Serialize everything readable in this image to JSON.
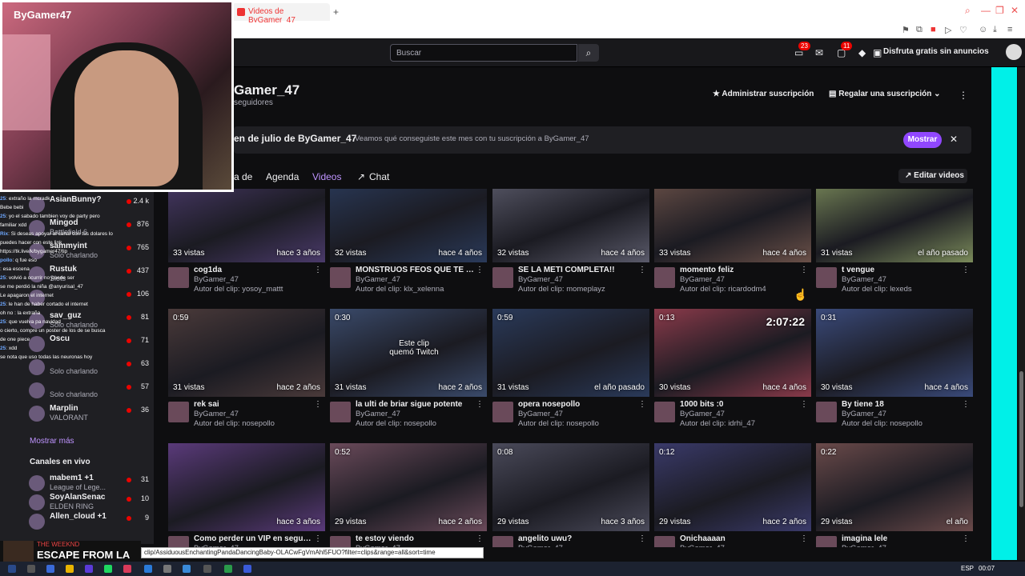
{
  "browser": {
    "tab_title": "Videos de ByGamer_47",
    "new_tab": "+",
    "win_controls": [
      "⌕",
      "—",
      "❐",
      "✕"
    ]
  },
  "topnav": {
    "search_placeholder": "Buscar",
    "notif_badge_1": "23",
    "notif_badge_2": "11",
    "adfree_label": "Disfruta gratis sin anuncios"
  },
  "webcam": {
    "logo_text": "ByGamer47"
  },
  "channel": {
    "name": "Gamer_47",
    "followers": "seguidores",
    "manage_sub": "Administrar suscripción",
    "gift_sub": "Regalar una suscripción"
  },
  "banner": {
    "title": "en de julio de ByGamer_47",
    "desc": "Veamos qué conseguiste este mes con tu suscripción a ByGamer_47",
    "show_btn": "Mostrar"
  },
  "tabs": {
    "t0": "a de",
    "t1": "Agenda",
    "t2": "Videos",
    "t3": "Chat",
    "edit": "Editar videos"
  },
  "sidebar": {
    "followed": [
      {
        "name": "AsianBunny?",
        "game": "",
        "viewers": "2.4 k"
      },
      {
        "name": "Mingod",
        "game": "Battlefield 6",
        "viewers": "876"
      },
      {
        "name": "sammyint",
        "game": "Solo charlando",
        "viewers": "765"
      },
      {
        "name": "Rustuk",
        "game": "Slots",
        "viewers": "437"
      },
      {
        "name": "",
        "game": "",
        "viewers": "106"
      },
      {
        "name": "sav_guz",
        "game": "Solo charlando",
        "viewers": "81"
      },
      {
        "name": "Oscu",
        "game": "",
        "viewers": "71"
      },
      {
        "name": "",
        "game": "Solo charlando",
        "viewers": "63"
      },
      {
        "name": "",
        "game": "Solo charlando",
        "viewers": "57"
      },
      {
        "name": "Marplin",
        "game": "VALORANT",
        "viewers": "36"
      }
    ],
    "show_more": "Mostrar más",
    "live_header": "Canales en vivo",
    "live": [
      {
        "name": "mabem1 +1",
        "game": "League of Lege...",
        "viewers": "31"
      },
      {
        "name": "SoyAlanSenac",
        "game": "ELDEN RING",
        "viewers": "10"
      },
      {
        "name": "Allen_cloud +1",
        "game": "",
        "viewers": "9"
      }
    ]
  },
  "chat_overlay": [
    {
      "u": "25",
      "t": ": extraño la mcradk"
    },
    {
      "u": "",
      "t": "Bebe bebi"
    },
    {
      "u": "25",
      "t": ": yo el sabado tambien voy de party pero"
    },
    {
      "u": "",
      "t": "familiar xdd"
    },
    {
      "u": "Rix",
      "t": ": Si deseas apoyar al canal con tus dolares lo"
    },
    {
      "u": "",
      "t": "puedes hacer con este link"
    },
    {
      "u": "",
      "t": "https://tk.live/k/bygamer47/tip"
    },
    {
      "u": "pollo",
      "t": ": q fue eso"
    },
    {
      "u": "",
      "t": ": esa escena"
    },
    {
      "u": "25",
      "t": ": volvió a ocurrir no puede ser"
    },
    {
      "u": "",
      "t": "se me perdió la niña @anyurisal_47"
    },
    {
      "u": "",
      "t": "Le apagaron el internet"
    },
    {
      "u": "25",
      "t": ": le han de haber cortado el internet"
    },
    {
      "u": "",
      "t": "oh no : la extraña"
    },
    {
      "u": "25",
      "t": ": que vuelva pa navidad"
    },
    {
      "u": "",
      "t": "o cierto, compre un poster de los de se busca"
    },
    {
      "u": "",
      "t": "de one piece"
    },
    {
      "u": "25",
      "t": ": xdd"
    },
    {
      "u": "",
      "t": "se nota que uso todas las neuronas hoy"
    }
  ],
  "clips": [
    {
      "title": "cog1da",
      "owner": "ByGamer_47",
      "author": "Autor del clip: yosoy_mattt",
      "views": "33 vistas",
      "ago": "hace 3 años",
      "dur": "",
      "color": "#4a3a6a"
    },
    {
      "title": "MONSTRUOS FEOS QUE TE Q...",
      "owner": "ByGamer_47",
      "author": "Autor del clip: klx_xelenna",
      "views": "32 vistas",
      "ago": "hace 4 años",
      "dur": "",
      "color": "#2a3a5a"
    },
    {
      "title": "SE LA METI COMPLETA!!",
      "owner": "ByGamer_47",
      "author": "Autor del clip: momeplayz",
      "views": "32 vistas",
      "ago": "hace 4 años",
      "dur": "",
      "color": "#5a5a6a"
    },
    {
      "title": "momento feliz",
      "owner": "ByGamer_47",
      "author": "Autor del clip: ricardodm4",
      "views": "33 vistas",
      "ago": "hace 4 años",
      "dur": "",
      "color": "#6a5048"
    },
    {
      "title": "t vengue",
      "owner": "ByGamer_47",
      "author": "Autor del clip: lexeds",
      "views": "31 vistas",
      "ago": "el año pasado",
      "dur": "",
      "color": "#7a8a5a"
    },
    {
      "title": "rek sai",
      "owner": "ByGamer_47",
      "author": "Autor del clip: nosepollo",
      "views": "31 vistas",
      "ago": "hace 2 años",
      "dur": "0:59",
      "color": "#4a3a3a"
    },
    {
      "title": "la ulti de briar sigue potente",
      "owner": "ByGamer_47",
      "author": "Autor del clip: nosepollo",
      "views": "31 vistas",
      "ago": "hace 2 años",
      "dur": "0:30",
      "color": "#3a4a6a",
      "overlay": "Este clip quemó Twitch"
    },
    {
      "title": "opera nosepollo",
      "owner": "ByGamer_47",
      "author": "Autor del clip: nosepollo",
      "views": "31 vistas",
      "ago": "el año pasado",
      "dur": "0:59",
      "color": "#2a3a5a"
    },
    {
      "title": "1000 bits :0",
      "owner": "ByGamer_47",
      "author": "Autor del clip: idrhi_47",
      "views": "30 vistas",
      "ago": "hace 4 años",
      "dur": "0:13",
      "color": "#8a3a4a",
      "big": "2:07:22"
    },
    {
      "title": "By tiene 18",
      "owner": "ByGamer_47",
      "author": "Autor del clip: nosepollo",
      "views": "30 vistas",
      "ago": "hace 4 años",
      "dur": "0:31",
      "color": "#3a4a7a"
    },
    {
      "title": "Como perder un VIP en segund...",
      "owner": "ByGamer_47",
      "author": "",
      "views": "",
      "ago": "hace 3 años",
      "dur": "",
      "color": "#5a3a7a"
    },
    {
      "title": "te estoy viendo",
      "owner": "ByGamer_47",
      "author": "",
      "views": "29 vistas",
      "ago": "hace 2 años",
      "dur": "0:52",
      "color": "#6a4a5a"
    },
    {
      "title": "angelito uwu?",
      "owner": "ByGamer_47",
      "author": "",
      "views": "29 vistas",
      "ago": "hace 3 años",
      "dur": "0:08",
      "color": "#4a4a5a"
    },
    {
      "title": "Onichaaaan",
      "owner": "ByGamer_47",
      "author": "",
      "views": "29 vistas",
      "ago": "hace 2 años",
      "dur": "0:12",
      "color": "#3a3a6a"
    },
    {
      "title": "imagina lele",
      "owner": "ByGamer_47",
      "author": "",
      "views": "29 vistas",
      "ago": "el año",
      "dur": "0:22",
      "color": "#6a4a4a"
    }
  ],
  "nowplaying": {
    "small": "THE WEEKND",
    "big": "ESCAPE FROM LA"
  },
  "status_url": "clip/AssiduousEnchantingPandaDancingBaby-OLACwFgVmAhl5FUO?filter=clips&range=all&sort=time",
  "taskbar": {
    "lang": "ESP",
    "time": "00:07"
  }
}
